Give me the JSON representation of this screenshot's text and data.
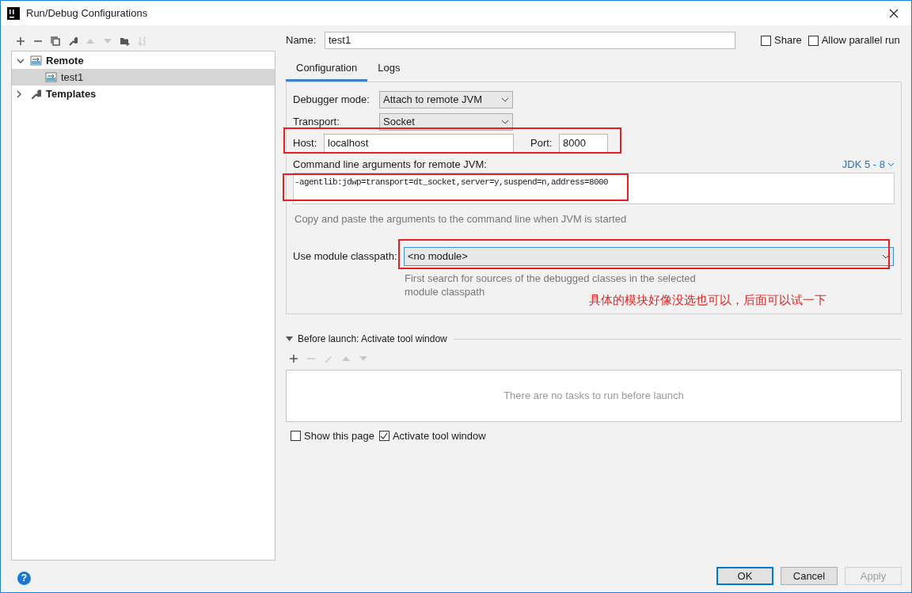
{
  "window": {
    "title": "Run/Debug Configurations"
  },
  "sidebar": {
    "toolbar": [
      {
        "kind": "add",
        "disabled": false
      },
      {
        "kind": "remove",
        "disabled": false
      },
      {
        "kind": "copy",
        "disabled": false
      },
      {
        "kind": "wrench",
        "disabled": false
      },
      {
        "kind": "up",
        "disabled": true
      },
      {
        "kind": "down",
        "disabled": true
      },
      {
        "kind": "folder",
        "disabled": false
      },
      {
        "kind": "sort",
        "disabled": true
      }
    ],
    "tree": [
      {
        "label": "Remote",
        "kind": "remote",
        "expanded": true,
        "selected": false,
        "children": [
          {
            "label": "test1",
            "kind": "remote",
            "selected": true
          }
        ]
      },
      {
        "label": "Templates",
        "kind": "wrench",
        "expanded": false,
        "selected": false
      }
    ]
  },
  "name": {
    "label": "Name:",
    "value": "test1"
  },
  "options": [
    {
      "label": "Share",
      "checked": false
    },
    {
      "label": "Allow parallel run",
      "checked": false
    }
  ],
  "tabs": [
    {
      "label": "Configuration",
      "selected": true
    },
    {
      "label": "Logs",
      "selected": false
    }
  ],
  "debugger_mode": {
    "label": "Debugger mode:",
    "value": "Attach to remote JVM"
  },
  "transport": {
    "label": "Transport:",
    "value": "Socket"
  },
  "host": {
    "label": "Host:",
    "value": "localhost"
  },
  "port": {
    "label": "Port:",
    "value": "8000"
  },
  "command_line": {
    "label": "Command line arguments for remote JVM:",
    "jdk_link": "JDK 5 - 8",
    "value": "-agentlib:jdwp=transport=dt_socket,server=y,suspend=n,address=8000",
    "hint": "Copy and paste the arguments to the command line when JVM is started"
  },
  "module_classpath": {
    "label": "Use module classpath:",
    "value": "<no module>",
    "hint": "First search for sources of the debugged classes in the selected module classpath"
  },
  "annotation": "具体的模块好像没选也可以，后面可以试一下",
  "before_launch": {
    "title": "Before launch: Activate tool window",
    "expanded": true,
    "toolbar": [
      {
        "kind": "add",
        "disabled": false
      },
      {
        "kind": "remove",
        "disabled": true
      },
      {
        "kind": "edit",
        "disabled": true
      },
      {
        "kind": "up",
        "disabled": true
      },
      {
        "kind": "down",
        "disabled": true
      }
    ],
    "empty_text": "There are no tasks to run before launch"
  },
  "launch_options": [
    {
      "label": "Show this page",
      "checked": false
    },
    {
      "label": "Activate tool window",
      "checked": true
    }
  ],
  "help": "?",
  "buttons": [
    {
      "label": "OK",
      "default": true,
      "disabled": false
    },
    {
      "label": "Cancel",
      "default": false,
      "disabled": false
    },
    {
      "label": "Apply",
      "default": false,
      "disabled": true
    }
  ]
}
